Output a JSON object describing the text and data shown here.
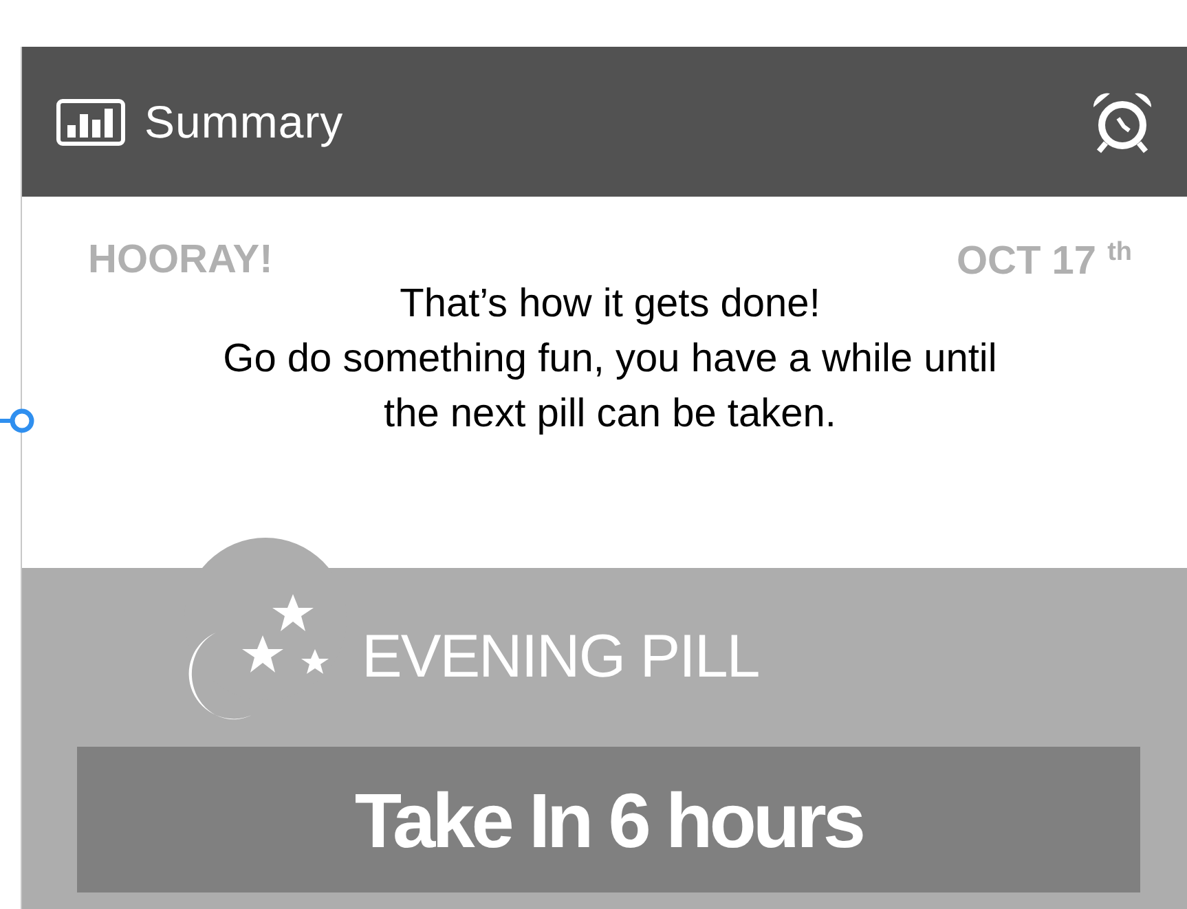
{
  "header": {
    "title": "Summary"
  },
  "summary": {
    "heading": "HOORAY!",
    "date": "OCT 17 $^{th}$",
    "message_lines": [
      "That’s how it gets done!",
      "Go do something fun, you have a while until",
      "the next pill can be taken."
    ]
  },
  "pill": {
    "name": "EVENING PILL",
    "action": "Take In 6 hours"
  }
}
